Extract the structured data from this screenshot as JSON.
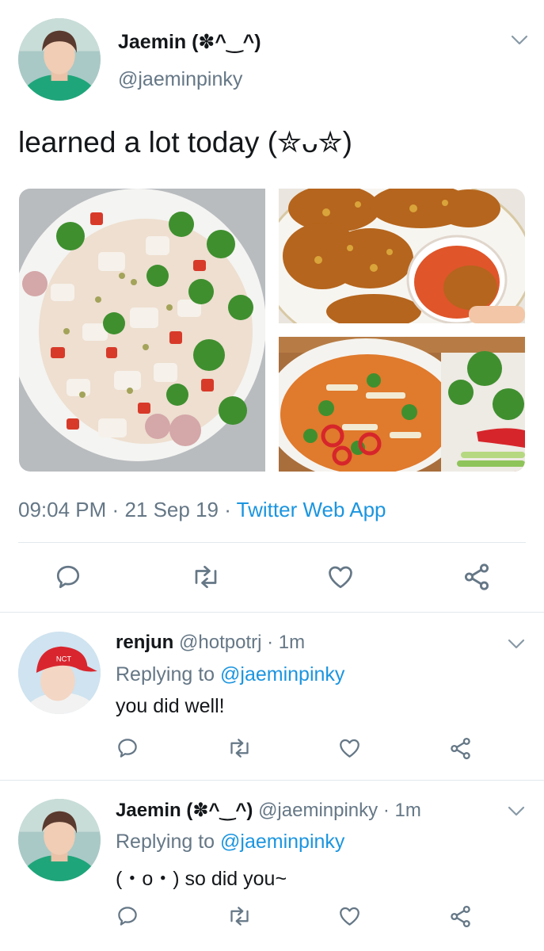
{
  "main_tweet": {
    "display_name": "Jaemin (✽^‿^)",
    "handle": "@jaeminpinky",
    "text": "learned a lot today (✮ᴗ✮)",
    "time": "09:04 PM",
    "date": "21 Sep 19",
    "source": "Twitter Web App",
    "separator": "·"
  },
  "replies": [
    {
      "display_name": "renjun",
      "handle": "@hotpotrj",
      "age": "1m",
      "replying_prefix": "Replying to",
      "replying_to": "@jaeminpinky",
      "text": "you did well!"
    },
    {
      "display_name": "Jaemin (✽^‿^)",
      "handle": "@jaeminpinky",
      "age": "1m",
      "replying_prefix": "Replying to",
      "replying_to": "@jaeminpinky",
      "text": "(・o・) so did you~"
    }
  ],
  "icons": {
    "reply": "reply-icon",
    "retweet": "retweet-icon",
    "like": "like-icon",
    "share": "share-icon",
    "menu": "chevron-down-icon"
  },
  "colors": {
    "link": "#1b95e0",
    "muted": "#657786",
    "icon": "#657786",
    "divider": "#e1e8ed"
  }
}
